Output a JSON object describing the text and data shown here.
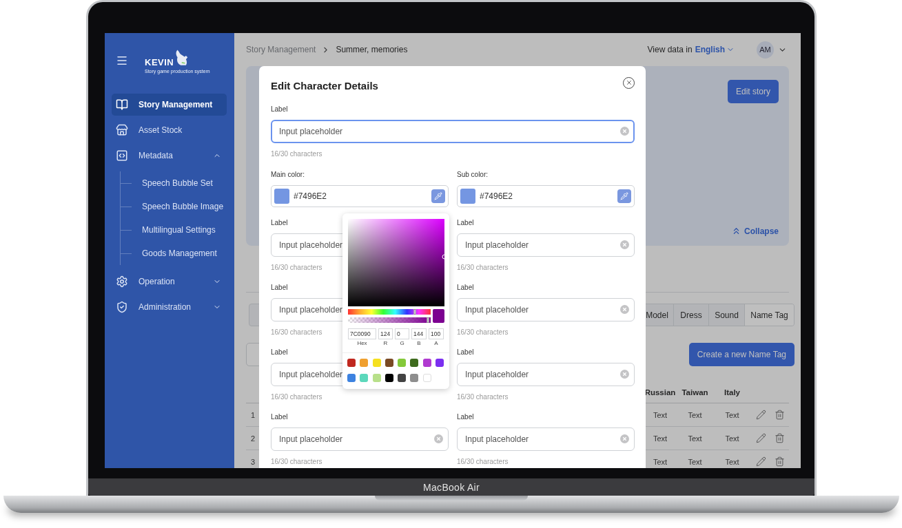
{
  "device_label": "MacBook Air",
  "sidebar": {
    "logo": {
      "name": "KEVIN",
      "tagline": "Story game production system"
    },
    "items": [
      {
        "kind": "link",
        "label": "Story Management",
        "selected": true
      },
      {
        "kind": "link",
        "label": "Asset Stock",
        "selected": false
      },
      {
        "kind": "group",
        "label": "Metadata",
        "selected": false,
        "expanded": true,
        "children": [
          {
            "label": "Speech Bubble Set",
            "selected": false
          },
          {
            "label": "Speech Bubble Image",
            "selected": false
          },
          {
            "label": "Multilingual Settings",
            "selected": false
          },
          {
            "label": "Goods Management",
            "selected": false
          }
        ]
      },
      {
        "kind": "group",
        "label": "Operation",
        "selected": false,
        "expanded": false
      },
      {
        "kind": "group",
        "label": "Administration",
        "selected": false,
        "expanded": false
      }
    ]
  },
  "header": {
    "breadcrumb": [
      "Story Management",
      "Summer, memories"
    ],
    "view_data_label": "View data in",
    "language": "English",
    "avatar": "AM"
  },
  "story_card": {
    "edit_button": "Edit story",
    "collapse": "Collapse"
  },
  "segments": [
    {
      "label": "Model",
      "selected": false
    },
    {
      "label": "Dress",
      "selected": false
    },
    {
      "label": "Sound",
      "selected": false
    },
    {
      "label": "Name Tag",
      "selected": true
    }
  ],
  "create_button": "Create a new Name Tag",
  "table": {
    "columns": [
      "Russian",
      "Taiwan",
      "Italy"
    ],
    "rows": [
      {
        "index": "1",
        "cells": [
          "Text",
          "Text",
          "Text"
        ]
      },
      {
        "index": "2",
        "cells": [
          "Text",
          "Text",
          "Text"
        ]
      },
      {
        "index": "3",
        "cells": [
          "Text",
          "Text",
          "Text"
        ]
      }
    ]
  },
  "modal": {
    "title": "Edit Character Details",
    "main_field": {
      "label": "Label",
      "placeholder": "Input placeholder",
      "hint": "16/30 characters",
      "focused": true,
      "clear_button": true
    },
    "main_color": {
      "label": "Main color:",
      "value": "#7496E2"
    },
    "sub_color": {
      "label": "Sub color:",
      "value": "#7496E2"
    },
    "fields": [
      {
        "label": "Label",
        "placeholder": "Input placeholder",
        "hint": "16/30 characters",
        "focused": false,
        "clear_button": false
      },
      {
        "label": "Label",
        "placeholder": "Input placeholder",
        "hint": "16/30 characters",
        "focused": false,
        "clear_button": true
      },
      {
        "label": "Label",
        "placeholder": "Input placeholder",
        "hint": "16/30 characters",
        "focused": false,
        "clear_button": false
      },
      {
        "label": "Label",
        "placeholder": "Input placeholder",
        "hint": "16/30 characters",
        "focused": false,
        "clear_button": true
      },
      {
        "label": "Label",
        "placeholder": "Input placeholder",
        "hint": "16/30 characters",
        "focused": false,
        "clear_button": false
      },
      {
        "label": "Label",
        "placeholder": "Input placeholder",
        "hint": "16/30 characters",
        "focused": false,
        "clear_button": true
      },
      {
        "label": "Label",
        "placeholder": "Input placeholder",
        "hint": "16/30 characters",
        "focused": false,
        "clear_button": true
      },
      {
        "label": "Label",
        "placeholder": "Input placeholder",
        "hint": "16/30 characters",
        "focused": false,
        "clear_button": true
      }
    ],
    "color_picker": {
      "hex": "7C0090",
      "r": "124",
      "g": "0",
      "b": "144",
      "a": "100",
      "channel_labels": [
        "Hex",
        "R",
        "G",
        "B",
        "A"
      ],
      "swatches": [
        {
          "color": "#c0281f"
        },
        {
          "color": "#f0a030"
        },
        {
          "color": "#f5e020"
        },
        {
          "color": "#7a4a25"
        },
        {
          "color": "#84c93a"
        },
        {
          "color": "#3e6b1d"
        },
        {
          "color": "#b03ad0"
        },
        {
          "color": "#7b2ff0"
        },
        {
          "color": "#3d82e0"
        },
        {
          "color": "#5cd8bb"
        },
        {
          "color": "#b8e08a"
        },
        {
          "color": "#000000"
        },
        {
          "color": "#434343"
        },
        {
          "color": "#8e8e8e"
        },
        {
          "color": "#ffffff"
        }
      ]
    }
  }
}
